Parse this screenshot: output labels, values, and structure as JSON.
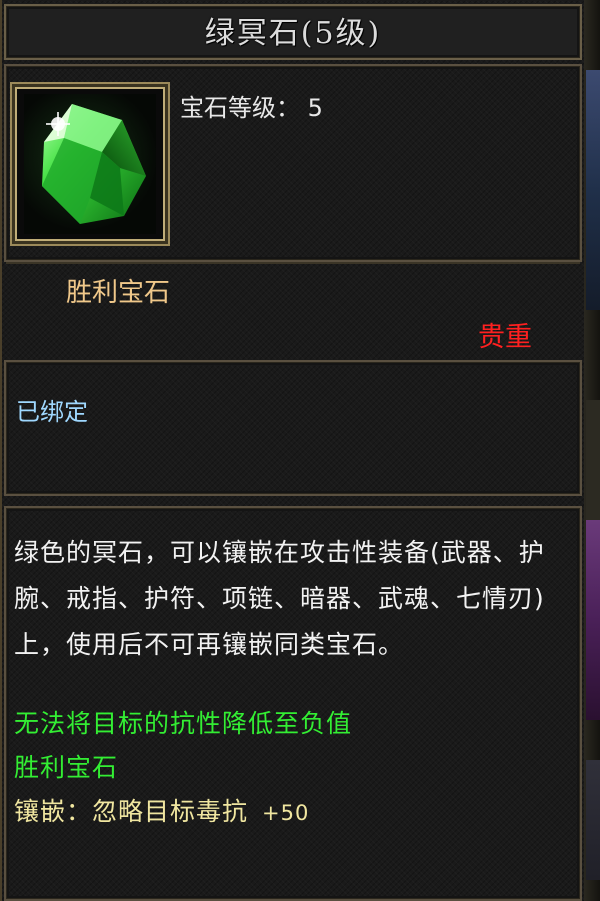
{
  "item": {
    "title": "绿冥石(5级)",
    "level_label": "宝石等级：",
    "level_value": "5",
    "gem_name": "胜利宝石",
    "quality": "贵重",
    "bind_status": "已绑定",
    "description": "绿色的冥石，可以镶嵌在攻击性装备(武器、护腕、戒指、护符、项链、暗器、武魂、七情刃)上，使用后不可再镶嵌同类宝石。",
    "effect_line": "无法将目标的抗性降低至负值",
    "set_name": "胜利宝石",
    "inlay_label": "镶嵌：忽略目标毒抗",
    "inlay_value": "+50",
    "icon": "green-gem-icon"
  },
  "colors": {
    "title": "#dcdcdc",
    "gem_name": "#f0c88a",
    "quality": "#ff2020",
    "bind": "#9fd8ff",
    "effect": "#33ee33",
    "inlay": "#f0e6a0"
  }
}
